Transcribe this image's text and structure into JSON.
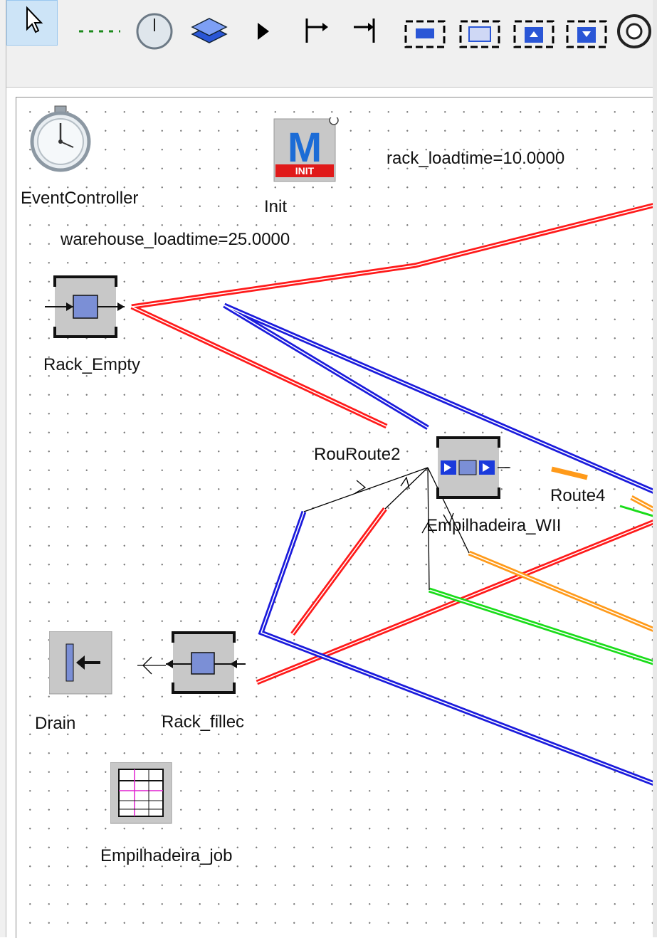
{
  "canvas": {
    "objects": {
      "event_controller": {
        "label": "EventController"
      },
      "init": {
        "label": "Init",
        "badge": "INIT",
        "glyph": "M"
      },
      "rack_empty": {
        "label": "Rack_Empty"
      },
      "route2": {
        "label": "RouRoute2"
      },
      "empilhadeira_wip": {
        "label": "Empilhadeira_WII"
      },
      "route4": {
        "label": "Route4"
      },
      "drain": {
        "label": "Drain"
      },
      "rack_filled": {
        "label": "Rack_fillec"
      },
      "empilhadeira_jobs": {
        "label": "Empilhadeira_job"
      }
    },
    "variables": {
      "rack_loadtime": "rack_loadtime=10.0000",
      "warehouse_loadtime": "warehouse_loadtime=25.0000"
    }
  },
  "colors": {
    "route_red": "#ff1a1a",
    "route_blue": "#1a1adc",
    "route_orange": "#ff9a1a",
    "route_green": "#1adc1a",
    "connector": "#000000",
    "selected_tool": "#cde4f7"
  }
}
